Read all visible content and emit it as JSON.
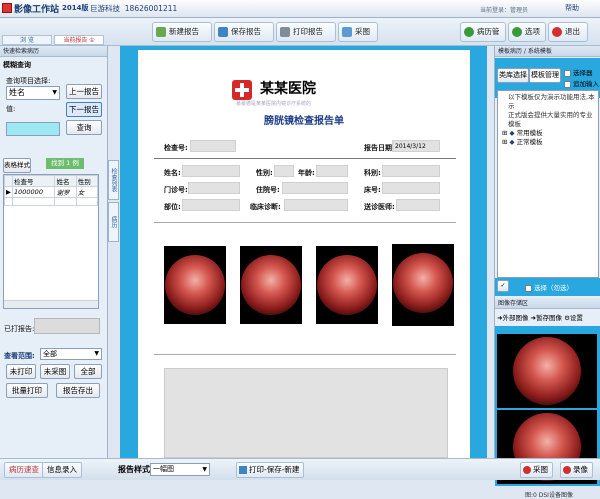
{
  "title": {
    "app": "影像工作站",
    "version": "2014版",
    "company": "巨游科技",
    "phone": "18626001211",
    "user": "当前登录：管理员",
    "help": "帮助"
  },
  "tabs": [
    "浏 览",
    "当前报告 ①"
  ],
  "toolbar": [
    "新建报告",
    "保存报告",
    "打印报告",
    "采图"
  ],
  "toolbar_right": [
    "病历管理",
    "选项",
    "退出"
  ],
  "left": {
    "panel_title": "快速检索病历",
    "section": "模糊查询",
    "item_label": "查询项目选择:",
    "item_value": "姓名",
    "value_label": "值:",
    "btn_prev": "上一报告",
    "btn_next": "下一报告",
    "btn_query": "查询",
    "table_style": "表格样式",
    "found": "找到 1 例",
    "columns": [
      "检查号",
      "姓名",
      "性别"
    ],
    "rows": [
      [
        "1000000",
        "谢罗",
        "女"
      ]
    ],
    "printed_label": "已打报告:",
    "range_label": "查看范围:",
    "range_value": "全部",
    "filters": [
      "未打印",
      "未采图",
      "全部"
    ],
    "batch": [
      "批量打印",
      "报告存出"
    ]
  },
  "vtabs": [
    "检查列表",
    "病历"
  ],
  "report": {
    "hospital": "某某医院",
    "subtitle": "慕慕德是某某医院内镜诊疗系统的",
    "title": "膀胱镜检查报告单",
    "exam_no": "检查号:",
    "date_label": "报告日期:",
    "date": "2014/3/12",
    "f_name": "姓名:",
    "f_sex": "性别:",
    "f_age": "年龄:",
    "f_dept": "科别:",
    "f_clinic": "门诊号:",
    "f_inpatient": "住院号:",
    "f_bed": "床号:",
    "f_site": "部位:",
    "f_diag": "临床诊断:",
    "f_doctor": "送诊医师:"
  },
  "right": {
    "panel_title": "模板病历 / 系统模板",
    "tab1": "类库选择",
    "tab2": "模板管理",
    "opt1": "选择器",
    "opt2": "追加输入",
    "tree": [
      "以下模板仅为演示功能用法,本示",
      "正式版会提供大量实用的专业模板",
      "常用模板",
      "正常模板"
    ],
    "pick_label": "选择（勿选）",
    "img_panel": "图像存储区",
    "img_tabs": [
      "外部图像",
      "暂存图像",
      "设置"
    ],
    "status": "图:0    DSI设备图像"
  },
  "bottom": {
    "left": [
      "病历速查",
      "信息录入"
    ],
    "style_label": "报告样式:",
    "style_value": "一幅图",
    "print_btn": "打印-保存-新建",
    "right": [
      "采图",
      "录像"
    ]
  }
}
